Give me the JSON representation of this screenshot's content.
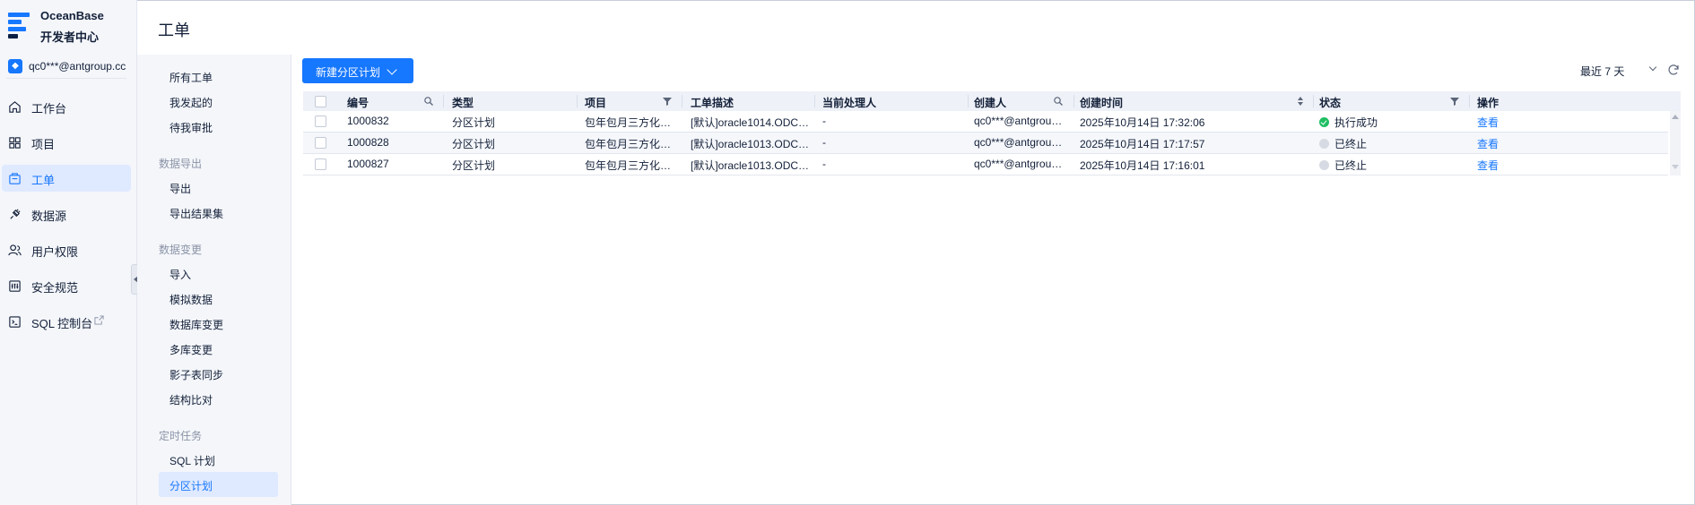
{
  "brand": {
    "name_line1": "OceanBase",
    "name_line2": "开发者中心",
    "logo_icon": "oceanbase-logo"
  },
  "org": {
    "label": "qc0***@antgroup.cc",
    "icon": "org-icon"
  },
  "nav": {
    "items": [
      {
        "label": "工作台",
        "icon": "home-icon",
        "active": false
      },
      {
        "label": "项目",
        "icon": "grid-icon",
        "active": false
      },
      {
        "label": "工单",
        "icon": "ticket-icon",
        "active": true
      },
      {
        "label": "数据源",
        "icon": "plug-icon",
        "active": false
      },
      {
        "label": "用户权限",
        "icon": "users-icon",
        "active": false
      },
      {
        "label": "安全规范",
        "icon": "shield-icon",
        "active": false
      },
      {
        "label": "SQL 控制台",
        "icon": "terminal-icon",
        "active": false,
        "external": true
      }
    ]
  },
  "header": {
    "title": "工单"
  },
  "subnav": {
    "top_items": [
      "所有工单",
      "我发起的",
      "待我审批"
    ],
    "groups": [
      {
        "title": "数据导出",
        "items": [
          "导出",
          "导出结果集"
        ]
      },
      {
        "title": "数据变更",
        "items": [
          "导入",
          "模拟数据",
          "数据库变更",
          "多库变更",
          "影子表同步",
          "结构比对"
        ]
      },
      {
        "title": "定时任务",
        "items": [
          "SQL 计划",
          "分区计划"
        ]
      }
    ],
    "active": "分区计划"
  },
  "toolbar": {
    "create_label": "新建分区计划",
    "range_label": "最近 7 天"
  },
  "table": {
    "columns": [
      "编号",
      "类型",
      "项目",
      "工单描述",
      "当前处理人",
      "创建人",
      "创建时间",
      "状态",
      "操作"
    ],
    "rows": [
      {
        "id": "1000832",
        "type": "分区计划",
        "project": "包年包月三方化…",
        "desc": "[默认]oracle1014.ODC…",
        "handler": "-",
        "creator": "qc0***@antgrou…",
        "created": "2025年10月14日 17:32:06",
        "status": "执行成功",
        "status_kind": "ok",
        "action": "查看"
      },
      {
        "id": "1000828",
        "type": "分区计划",
        "project": "包年包月三方化…",
        "desc": "[默认]oracle1013.ODC…",
        "handler": "-",
        "creator": "qc0***@antgrou…",
        "created": "2025年10月14日 17:17:57",
        "status": "已终止",
        "status_kind": "stop",
        "action": "查看"
      },
      {
        "id": "1000827",
        "type": "分区计划",
        "project": "包年包月三方化…",
        "desc": "[默认]oracle1013.ODC…",
        "handler": "-",
        "creator": "qc0***@antgrou…",
        "created": "2025年10月14日 17:16:01",
        "status": "已终止",
        "status_kind": "stop",
        "action": "查看"
      }
    ]
  },
  "colors": {
    "accent": "#1677ff",
    "success": "#1fbe62",
    "muted": "#d6dae2"
  }
}
